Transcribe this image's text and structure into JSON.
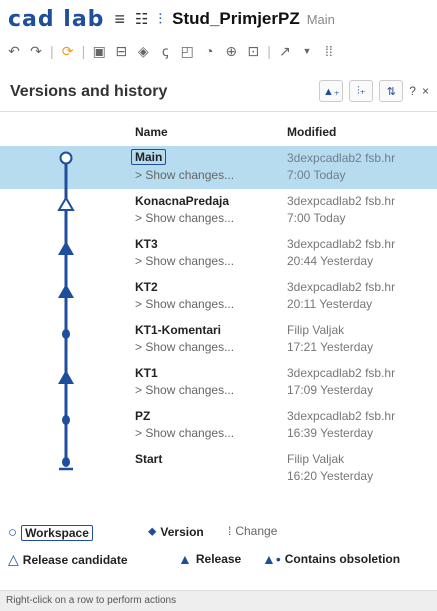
{
  "app": {
    "logo": "cad lab",
    "doc_title": "Stud_PrimjerPZ",
    "branch": "Main",
    "icons": [
      "hamburger-menu-icon",
      "feature-list-icon",
      "version-graph-icon"
    ]
  },
  "panel": {
    "title": "Versions and history",
    "help": "?",
    "close": "×"
  },
  "columns": {
    "name": "Name",
    "modified": "Modified"
  },
  "rows": [
    {
      "name": "Main",
      "show": "> Show changes...",
      "author": "3dexpcadlab2 fsb.hr",
      "time": "7:00 Today",
      "selected": true
    },
    {
      "name": "KonacnaPredaja",
      "show": "> Show changes...",
      "author": "3dexpcadlab2 fsb.hr",
      "time": "7:00 Today"
    },
    {
      "name": "KT3",
      "show": "> Show changes...",
      "author": "3dexpcadlab2 fsb.hr",
      "time": "20:44 Yesterday"
    },
    {
      "name": "KT2",
      "show": "> Show changes...",
      "author": "3dexpcadlab2 fsb.hr",
      "time": "20:11 Yesterday"
    },
    {
      "name": "KT1-Komentari",
      "show": "> Show changes...",
      "author": "Filip Valjak",
      "time": "17:21 Yesterday"
    },
    {
      "name": "KT1",
      "show": "> Show changes...",
      "author": "3dexpcadlab2 fsb.hr",
      "time": "17:09 Yesterday"
    },
    {
      "name": "PZ",
      "show": "> Show changes...",
      "author": "3dexpcadlab2 fsb.hr",
      "time": "16:39 Yesterday"
    },
    {
      "name": "Start",
      "show": "",
      "author": "Filip Valjak",
      "time": "16:20 Yesterday"
    }
  ],
  "legend": {
    "workspace": "Workspace",
    "version": "Version",
    "change": "Change",
    "release_candidate": "Release candidate",
    "release": "Release",
    "obsoletion": "Contains obsoletion"
  },
  "status": "Right-click on a row to perform actions",
  "colors": {
    "brand": "#1f4e9c",
    "selected_row": "#b7dcef",
    "graph": "#1f4e9c"
  }
}
